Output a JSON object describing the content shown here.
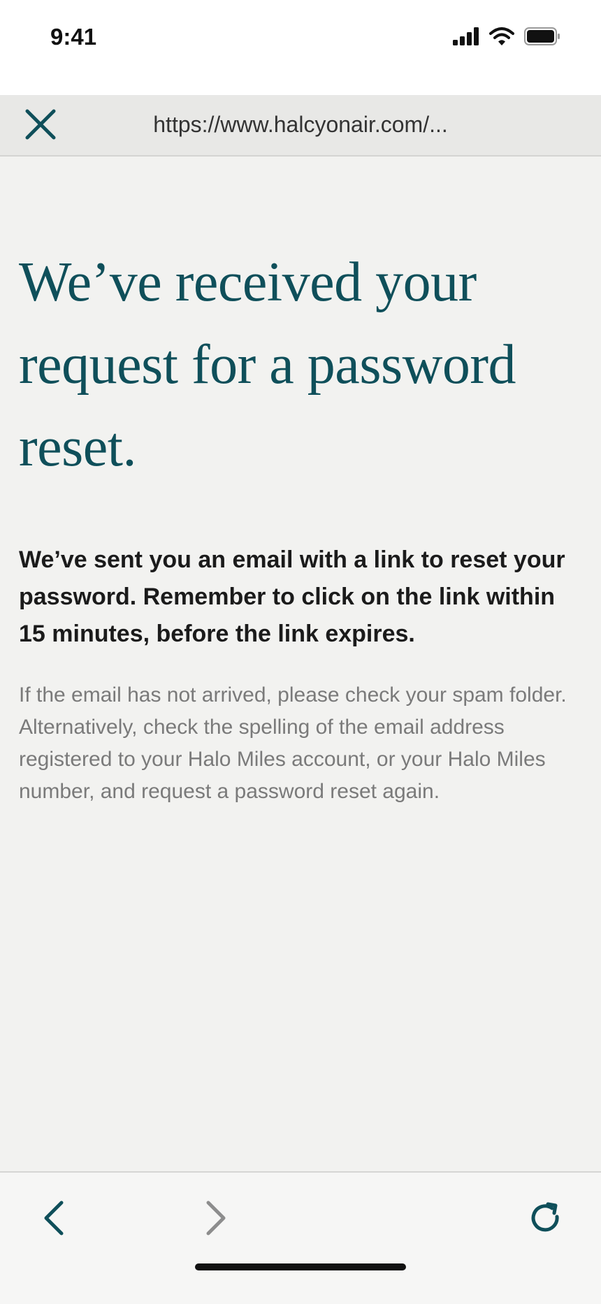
{
  "status_bar": {
    "time": "9:41",
    "icons": [
      "cellular-signal-icon",
      "wifi-icon",
      "battery-icon"
    ]
  },
  "browser": {
    "url": "https://www.halcyonair.com/...",
    "close_icon": "close-icon"
  },
  "main": {
    "headline_lines": [
      "We’ve received your",
      "request for a password",
      "reset."
    ],
    "lead": "We’ve sent you an email with a link to reset your password. Remember to click on the link within 15 minutes, before the link expires.",
    "note": "If the email has not arrived, please check your spam folder. Alternatively, check the spelling of the email address registered to your Halo Miles account, or your Halo Miles number, and request a password reset again."
  },
  "toolbar": {
    "icons": [
      "back-icon",
      "forward-icon",
      "reload-icon"
    ],
    "forward_enabled": false
  },
  "colors": {
    "accent": "#0f4f5a",
    "background": "#f2f2f0",
    "disabled": "#8d8d8d"
  }
}
